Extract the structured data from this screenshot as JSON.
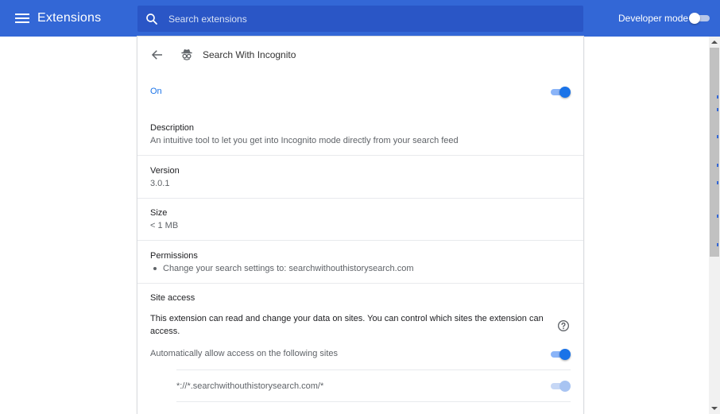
{
  "header": {
    "title": "Extensions",
    "search_placeholder": "Search extensions",
    "search_value": "",
    "developer_mode_label": "Developer mode",
    "developer_mode_on": false
  },
  "extension": {
    "name": "Search With Incognito",
    "state_label": "On",
    "enabled": true,
    "description": {
      "label": "Description",
      "text": "An intuitive tool to let you get into Incognito mode directly from your search feed"
    },
    "version": {
      "label": "Version",
      "value": "3.0.1"
    },
    "size": {
      "label": "Size",
      "value": "< 1 MB"
    },
    "permissions": {
      "label": "Permissions",
      "items": [
        "Change your search settings to: searchwithouthistorysearch.com"
      ]
    },
    "site_access": {
      "label": "Site access",
      "text": "This extension can read and change your data on sites. You can control which sites the extension can access.",
      "auto_allow_label": "Automatically allow access on the following sites",
      "auto_allow_on": true,
      "sites": [
        "*://*.searchwithouthistorysearch.com/*"
      ]
    }
  },
  "icons": {
    "menu": "hamburger-menu-icon",
    "search": "search-icon",
    "back": "arrow-left-icon",
    "extension": "incognito-spy-icon",
    "help": "help-circle-icon"
  },
  "colors": {
    "header_bg": "#3367d6",
    "accent": "#1a73e8",
    "text_primary": "#202124",
    "text_secondary": "#5f6368"
  }
}
